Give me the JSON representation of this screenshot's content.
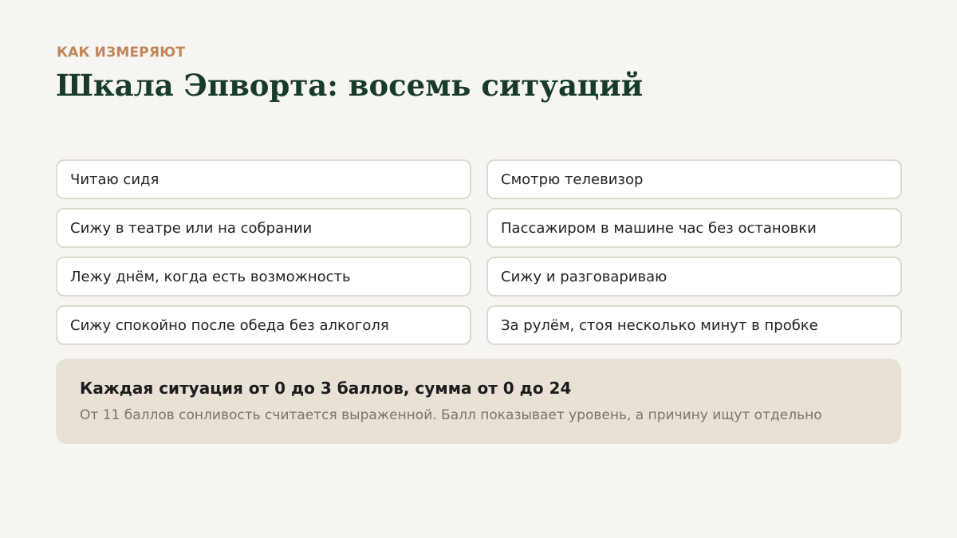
{
  "header": {
    "eyebrow": "КАК ИЗМЕРЯЮТ",
    "title": "Шкала Эпворта: восемь ситуаций"
  },
  "situations": [
    "Читаю сидя",
    "Смотрю телевизор",
    "Сижу в театре или на собрании",
    "Пассажиром в машине час без остановки",
    "Лежу днём, когда есть возможность",
    "Сижу и разговариваю",
    "Сижу спокойно после обеда без алкоголя",
    "За рулём, стоя несколько минут в пробке"
  ],
  "note": {
    "title": "Каждая ситуация от 0 до 3 баллов, сумма от 0 до 24",
    "text": "От 11 баллов сонливость считается выраженной. Балл показывает уровень, а причину ищут отдельно"
  },
  "colors": {
    "background": "#f6f5f1",
    "accent": "#c1855a",
    "title": "#173a2c",
    "card_border": "#dcd9cf",
    "note_background": "#e8e2d6"
  }
}
